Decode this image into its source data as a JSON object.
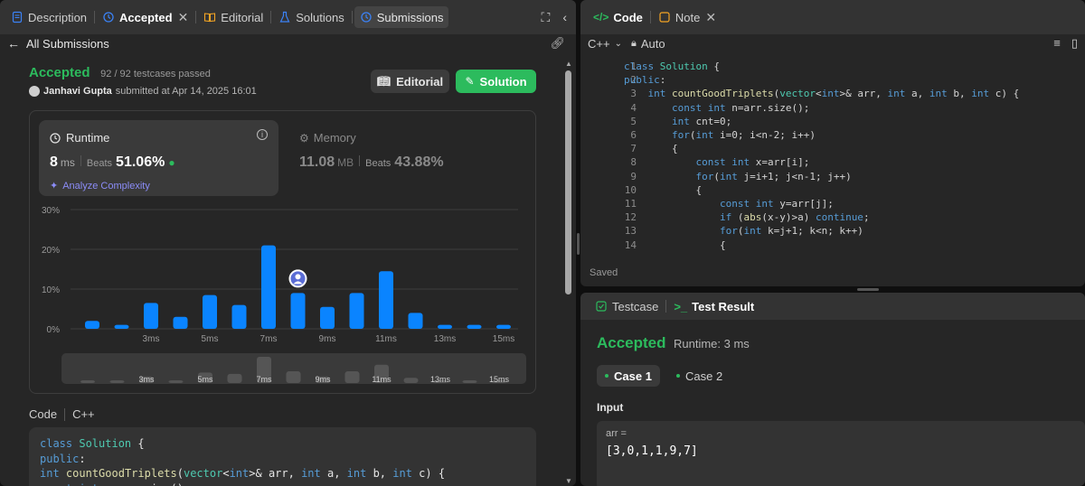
{
  "left_tabs": {
    "description": "Description",
    "accepted": "Accepted",
    "editorial": "Editorial",
    "solutions": "Solutions",
    "submissions": "Submissions"
  },
  "nav": {
    "all_submissions": "All Submissions"
  },
  "submission": {
    "status": "Accepted",
    "tests": "92 / 92 testcases passed",
    "user": "Janhavi Gupta",
    "submitted_text": "submitted at Apr 14, 2025 16:01"
  },
  "buttons": {
    "editorial": "Editorial",
    "solution": "Solution"
  },
  "runtime": {
    "label": "Runtime",
    "value": "8",
    "unit": "ms",
    "beats_label": "Beats",
    "beats_value": "51.06%",
    "analyze": "Analyze Complexity"
  },
  "memory": {
    "label": "Memory",
    "value": "11.08",
    "unit": "MB",
    "beats_label": "Beats",
    "beats_value": "43.88%"
  },
  "chart_data": {
    "type": "bar",
    "categories": [
      "1ms",
      "2ms",
      "3ms",
      "4ms",
      "5ms",
      "6ms",
      "7ms",
      "8ms",
      "9ms",
      "10ms",
      "11ms",
      "12ms",
      "13ms",
      "14ms",
      "15ms"
    ],
    "values": [
      2,
      1,
      6.5,
      3,
      8.5,
      6,
      21,
      9,
      5.5,
      9,
      14.5,
      4,
      1,
      1,
      1
    ],
    "x_tick_labels": [
      "3ms",
      "5ms",
      "7ms",
      "9ms",
      "11ms",
      "13ms",
      "15ms"
    ],
    "y_tick_labels": [
      "0%",
      "10%",
      "20%",
      "30%"
    ],
    "ylim": [
      0,
      30
    ],
    "highlight_index": 7,
    "bar_color": "#0a84ff",
    "overview_values": [
      1,
      1,
      2.5,
      1,
      4,
      3.5,
      10,
      4.5,
      2.5,
      4.5,
      7,
      2,
      0.8,
      0.8,
      0.8
    ]
  },
  "code_section": {
    "label": "Code",
    "lang": "C++",
    "lines": [
      "class Solution {",
      "public:",
      "    int countGoodTriplets(vector<int>& arr, int a, int b, int c) {",
      "        const int n=arr.size();"
    ]
  },
  "code_panel": {
    "tab_code": "Code",
    "tab_note": "Note",
    "language": "C++",
    "mode": "Auto",
    "saved": "Saved",
    "line_numbers": [
      "1",
      "2",
      "3",
      "4",
      "5",
      "6",
      "7",
      "8",
      "9",
      "10",
      "11",
      "12",
      "13",
      "14"
    ],
    "lines": [
      "class Solution {",
      "public:",
      "    int countGoodTriplets(vector<int>& arr, int a, int b, int c) {",
      "        const int n=arr.size();",
      "        int cnt=0;",
      "        for(int i=0; i<n-2; i++)",
      "        {",
      "            const int x=arr[i];",
      "            for(int j=i+1; j<n-1; j++)",
      "            {",
      "                const int y=arr[j];",
      "                if (abs(x-y)>a) continue;",
      "                for(int k=j+1; k<n; k++)",
      "                {"
    ]
  },
  "result_panel": {
    "tab_testcase": "Testcase",
    "tab_result": "Test Result",
    "status": "Accepted",
    "runtime": "Runtime: 3 ms",
    "case1": "Case 1",
    "case2": "Case 2",
    "input_label": "Input",
    "arr_label": "arr =",
    "arr_value": "[3,0,1,1,9,7]"
  },
  "colors": {
    "accent_green": "#2cbb5d",
    "bar_blue": "#0a84ff",
    "panel_bg": "#262626",
    "tab_bg": "#333333"
  }
}
